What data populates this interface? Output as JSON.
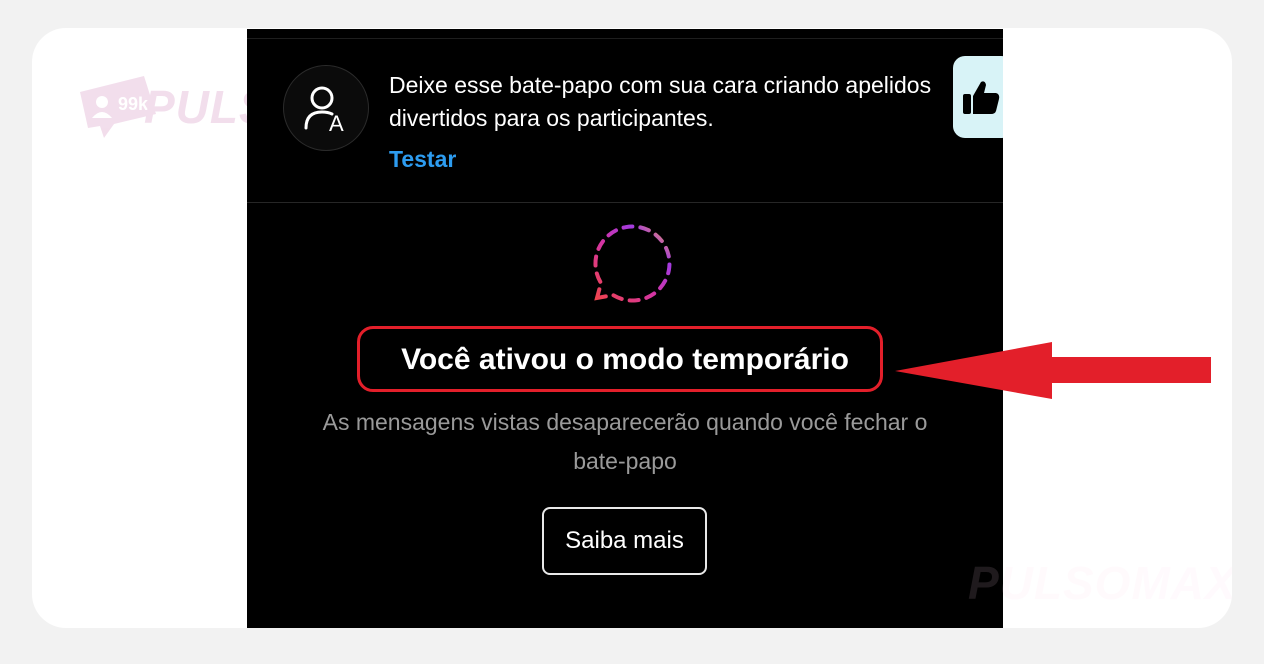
{
  "promo": {
    "message": "Deixe esse bate-papo com sua cara criando apelidos divertidos para os participantes.",
    "action_label": "Testar",
    "icon": "person-nickname-icon",
    "side_icon": "thumbs-up-icon"
  },
  "vanish_mode": {
    "icon": "dashed-chat-bubble-icon",
    "title": "Você ativou o modo temporário",
    "description": "As mensagens vistas desaparecerão quando você fechar o bate-papo",
    "button_label": "Saiba mais"
  },
  "watermark": {
    "brand": "PULSOMAX",
    "badge": "99k"
  },
  "annotation": {
    "arrow_color": "#e31f2a",
    "highlight_color": "#e31f2a"
  },
  "colors": {
    "background": "#000000",
    "link": "#2d9cf0",
    "muted_text": "#9a9a9a"
  }
}
